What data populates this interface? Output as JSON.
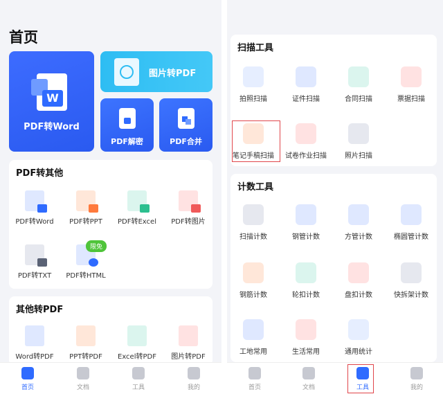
{
  "left": {
    "title": "首页",
    "cards": {
      "pdf_to_word": "PDF转Word",
      "image_to_pdf": "图片转PDF",
      "pdf_decrypt": "PDF解密",
      "pdf_merge": "PDF合并"
    },
    "section1": {
      "title": "PDF转其他",
      "items": [
        "PDF转Word",
        "PDF转PPT",
        "PDF转Excel",
        "PDF转图片",
        "PDF转TXT",
        "PDF转HTML"
      ],
      "badge": "限免"
    },
    "section2": {
      "title": "其他转PDF",
      "items": [
        "Word转PDF",
        "PPT转PDF",
        "Excel转PDF",
        "图片转PDF"
      ]
    },
    "tabs": [
      "首页",
      "文档",
      "工具",
      "我的"
    ]
  },
  "right": {
    "scan": {
      "title": "扫描工具",
      "items": [
        "拍照扫描",
        "证件扫描",
        "合同扫描",
        "票据扫描",
        "笔记手稿扫描",
        "试卷作业扫描",
        "照片扫描"
      ]
    },
    "count": {
      "title": "计数工具",
      "items": [
        "扫描计数",
        "钢管计数",
        "方管计数",
        "椭圆管计数",
        "钢筋计数",
        "轮扣计数",
        "盘扣计数",
        "快拆架计数",
        "工地常用",
        "生活常用",
        "通用统计"
      ]
    },
    "tabs": [
      "首页",
      "文档",
      "工具",
      "我的"
    ]
  }
}
